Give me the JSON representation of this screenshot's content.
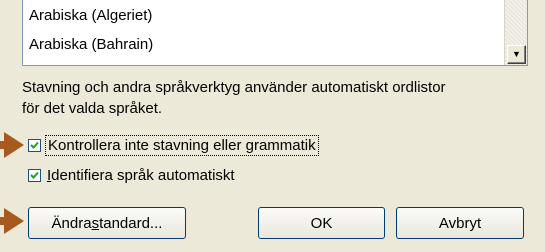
{
  "language_list": {
    "items": [
      "Arabiska (Algeriet)",
      "Arabiska (Bahrain)"
    ],
    "scroll_down_glyph": "▼"
  },
  "description": {
    "line1": "Stavning och andra språkverktyg använder automatiskt ordlistor",
    "line2": "för det valda språket."
  },
  "options": {
    "no_spelling_check": {
      "label": "Kontrollera inte stavning eller grammatik",
      "checked": true
    },
    "detect_language": {
      "label_before": "",
      "underlined": "I",
      "label_after": "dentifiera språk automatiskt",
      "checked": true
    }
  },
  "buttons": {
    "change_default": {
      "label_before": "Ändra ",
      "underlined": "s",
      "label_after": "tandard..."
    },
    "ok": "OK",
    "cancel": "Avbryt"
  },
  "colors": {
    "dialog_bg": "#ece9d8",
    "arrow": "#a85a1e",
    "button_border": "#003c74"
  }
}
